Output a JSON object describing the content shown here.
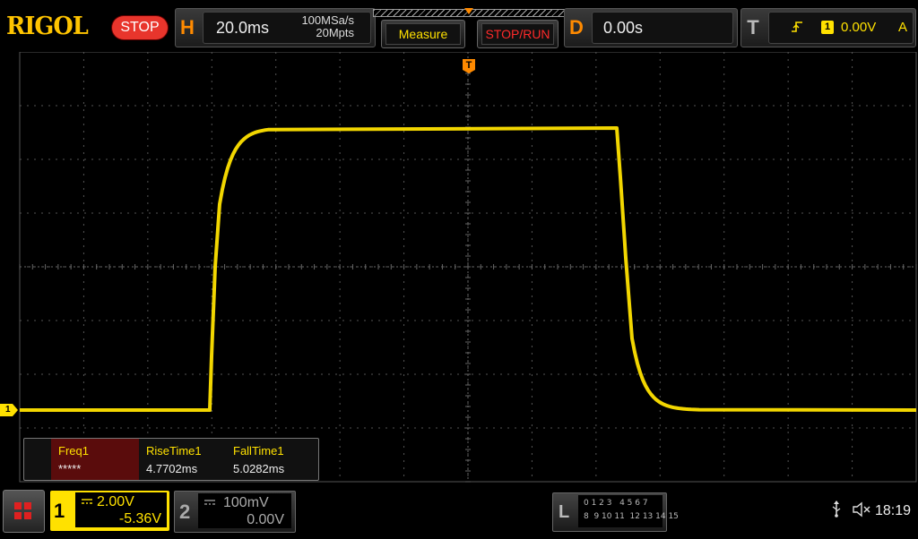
{
  "brand": {
    "logo": "RIGOL",
    "status": "STOP"
  },
  "horizontal": {
    "letter": "H",
    "timebase": "20.0ms",
    "sample_rate": "100MSa/s",
    "memory_depth": "20Mpts"
  },
  "buttons": {
    "measure": "Measure",
    "stop_run": "STOP/RUN"
  },
  "delay": {
    "letter": "D",
    "value": "0.00s"
  },
  "trigger": {
    "letter": "T",
    "source": "1",
    "level": "0.00V",
    "mode": "A",
    "marker": "T"
  },
  "channel1_marker": "1",
  "measurements": [
    {
      "label": "Freq1",
      "value": "*****"
    },
    {
      "label": "RiseTime1",
      "value": "4.7702ms"
    },
    {
      "label": "FallTime1",
      "value": "5.0282ms"
    }
  ],
  "channels": [
    {
      "number": "1",
      "coupling": "⎓",
      "scale": "2.00V",
      "offset": "-5.36V",
      "color": "#ffe100",
      "active": true
    },
    {
      "number": "2",
      "coupling": "⎓",
      "scale": "100mV",
      "offset": "0.00V",
      "color": "#aaaaaa",
      "active": false
    }
  ],
  "logic": {
    "letter": "L",
    "row1": "0 1 2 3   4 5 6 7",
    "row2": "8  9 10 11  12 13 14 15"
  },
  "status_bar": {
    "usb": "↡",
    "speaker": "✖",
    "time": "18:19"
  },
  "waveform": {
    "color": "#ffe100",
    "grid_divisions": {
      "horizontal": 14,
      "vertical": 8
    }
  }
}
